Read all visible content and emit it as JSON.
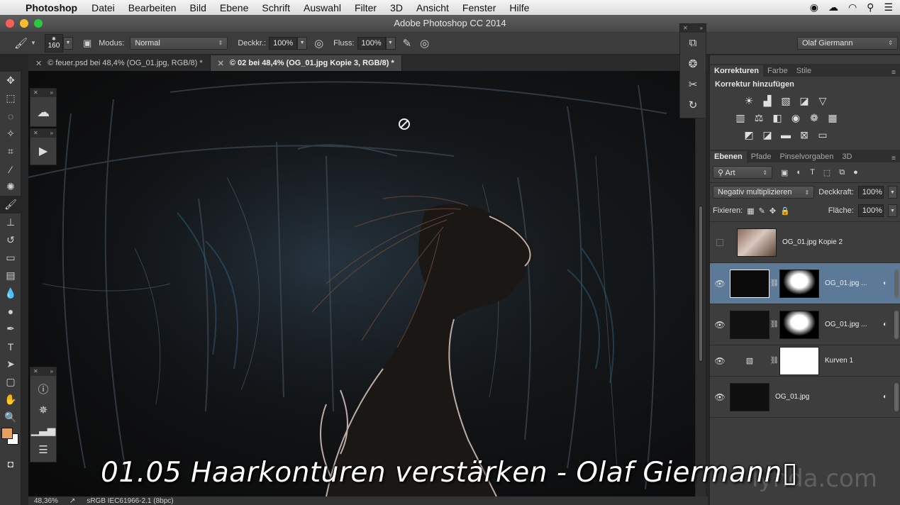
{
  "menubar": {
    "app_name": "Photoshop",
    "items": [
      "Datei",
      "Bearbeiten",
      "Bild",
      "Ebene",
      "Schrift",
      "Auswahl",
      "Filter",
      "3D",
      "Ansicht",
      "Fenster",
      "Hilfe"
    ]
  },
  "window": {
    "title": "Adobe Photoshop CC 2014"
  },
  "options_bar": {
    "brush_size": "160",
    "mode_label": "Modus:",
    "mode_value": "Normal",
    "opacity_label": "Deckkr.:",
    "opacity_value": "100%",
    "flow_label": "Fluss:",
    "flow_value": "100%",
    "workspace": "Olaf Giermann"
  },
  "document_tabs": [
    {
      "label": "© feuer.psd bei 48,4% (OG_01.jpg, RGB/8) *"
    },
    {
      "label": "© 02 bei 48,4% (OG_01.jpg Kopie 3, RGB/8) *"
    }
  ],
  "adjustments_panel": {
    "tabs": [
      "Korrekturen",
      "Farbe",
      "Stile"
    ],
    "title": "Korrektur hinzufügen"
  },
  "layers_panel": {
    "tabs": [
      "Ebenen",
      "Pfade",
      "Pinselvorgaben",
      "3D"
    ],
    "filter_kind": "Art",
    "blend_mode": "Negativ multiplizieren",
    "opacity_label": "Deckkraft:",
    "opacity_value": "100%",
    "lock_label": "Fixieren:",
    "fill_label": "Fläche:",
    "fill_value": "100%",
    "layers": [
      {
        "name": "OG_01.jpg Kopie 2"
      },
      {
        "name": "OG_01.jpg ..."
      },
      {
        "name": "OG_01.jpg ..."
      },
      {
        "name": "Kurven 1"
      },
      {
        "name": "OG_01.jpg"
      }
    ]
  },
  "status_bar": {
    "zoom": "48,36%",
    "profile": "sRGB IEC61966-2.1 (8bpc)"
  },
  "caption": "01.05 Haarkonturen verstärken - Olaf Giermann",
  "caption_glyph": "▯",
  "watermark": "lynda.com",
  "colors": {
    "foreground": "#e8a060",
    "background": "#ffffff",
    "selection": "#5c7a98"
  }
}
